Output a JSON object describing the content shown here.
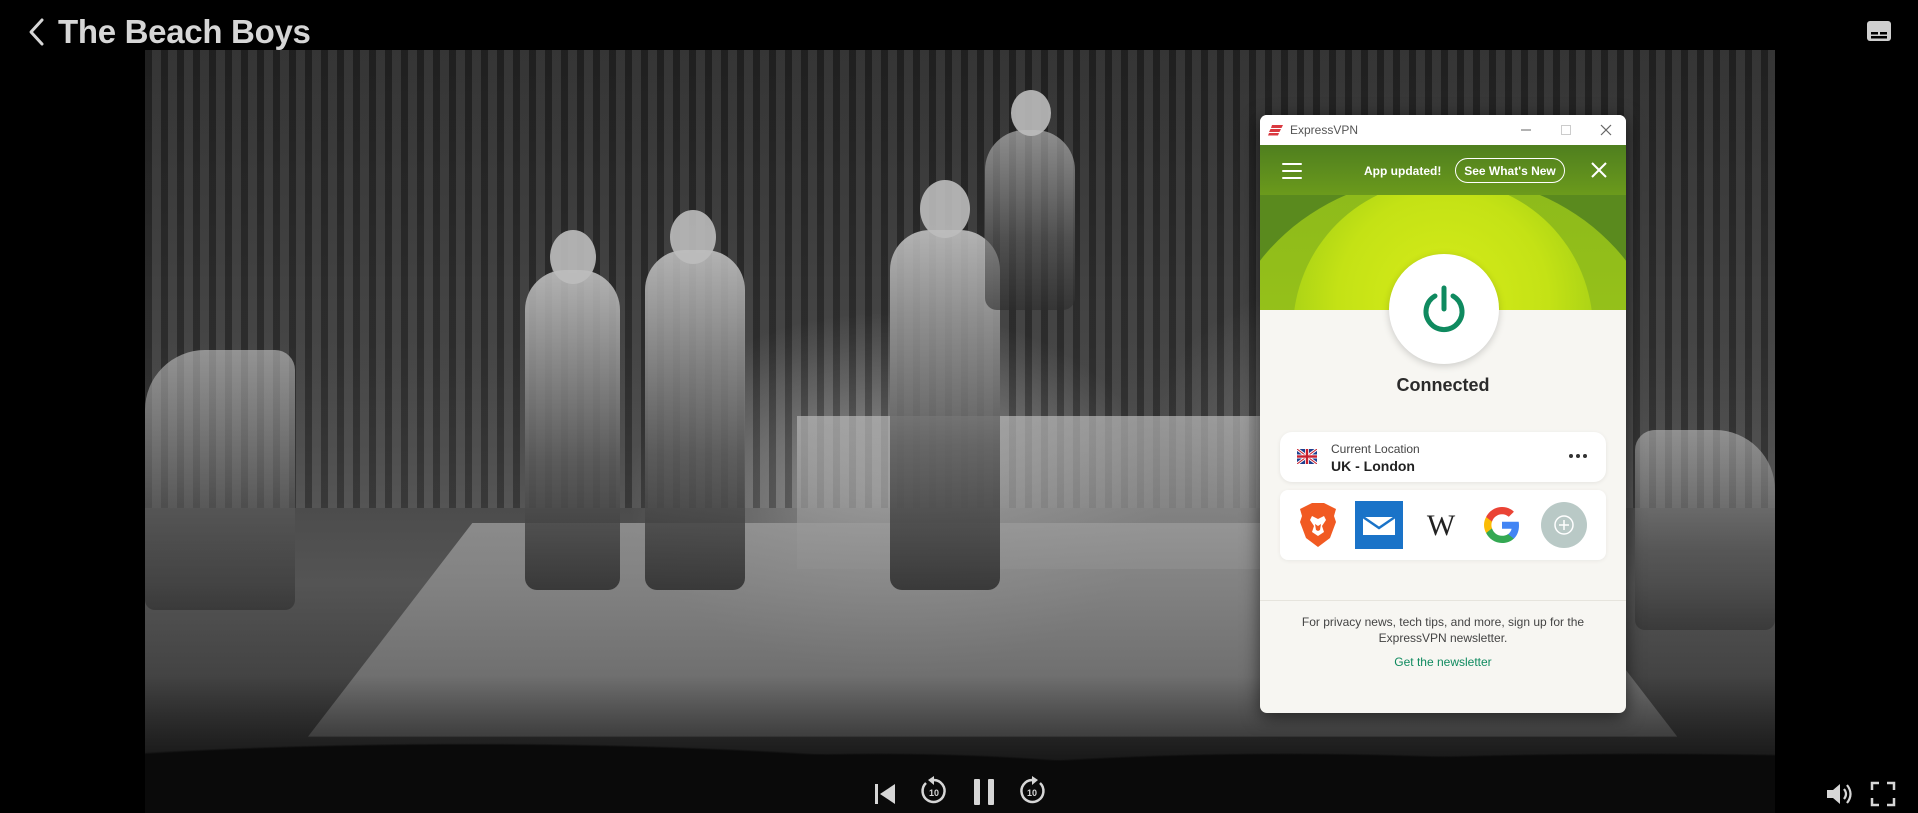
{
  "player": {
    "title": "The Beach Boys",
    "skip_back_label": "10",
    "skip_forward_label": "10"
  },
  "vpn": {
    "app_name": "ExpressVPN",
    "banner": {
      "message": "App updated!",
      "button": "See What's New"
    },
    "status": "Connected",
    "location": {
      "label": "Current Location",
      "value": "UK - London"
    },
    "shortcuts": [
      {
        "icon": "brave-icon"
      },
      {
        "icon": "mail-icon"
      },
      {
        "icon": "wikipedia-icon",
        "glyph": "W"
      },
      {
        "icon": "google-icon"
      },
      {
        "icon": "add-shortcut-icon"
      }
    ],
    "newsletter": {
      "text": "For privacy news, tech tips, and more, sign up for the ExpressVPN newsletter.",
      "link": "Get the newsletter"
    },
    "colors": {
      "brand_red": "#da3940",
      "hero_green": "#5a8a1e",
      "hero_yellow": "#d7ec1a",
      "power_teal": "#0f8a5f",
      "link_green": "#0f8a5f"
    }
  }
}
